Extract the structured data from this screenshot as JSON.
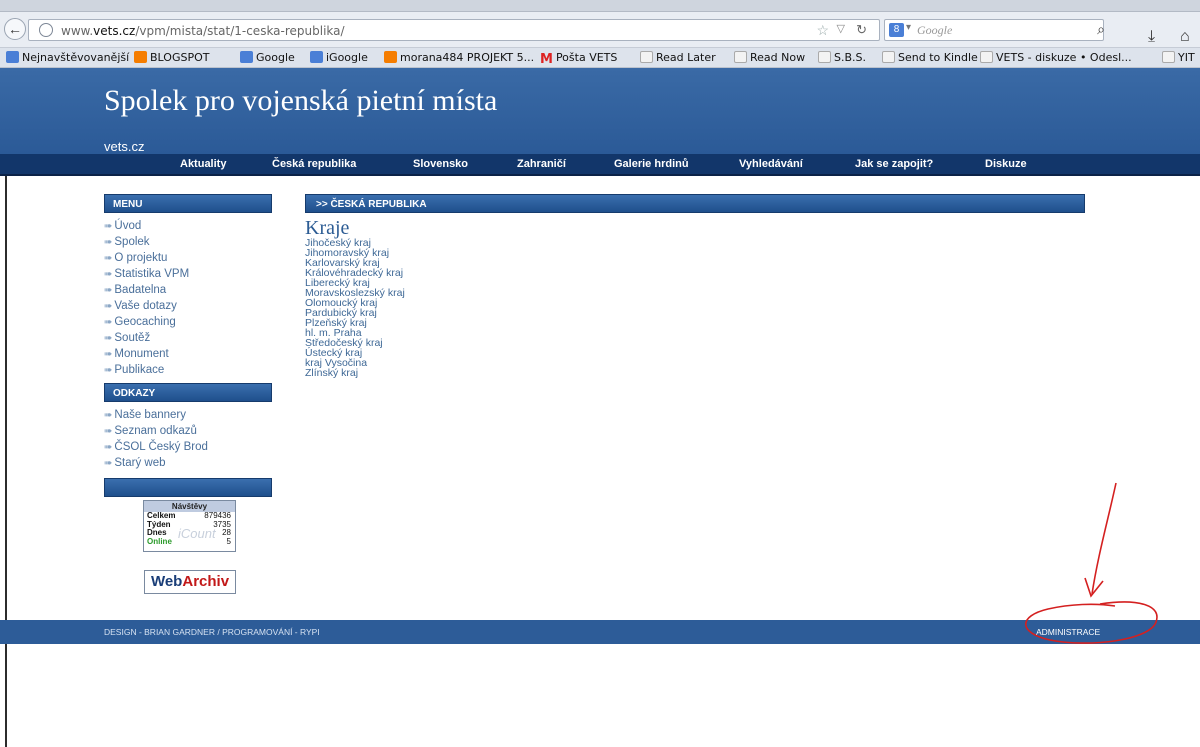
{
  "browser": {
    "url_prefix": "www.",
    "url_domain": "vets.cz",
    "url_path": "/vpm/mista/stat/1-ceska-republika/",
    "search_placeholder": "Google",
    "search_badge": "8",
    "bookmarks": [
      {
        "icon": "star",
        "label": "Nejnavštěvovanější"
      },
      {
        "icon": "blogger",
        "label": "BLOGSPOT"
      },
      {
        "icon": "google",
        "label": "Google"
      },
      {
        "icon": "google",
        "label": "iGoogle"
      },
      {
        "icon": "blogger",
        "label": "morana484 PROJEKT 5..."
      },
      {
        "icon": "gmail",
        "label": "Pošta VETS"
      },
      {
        "icon": "page",
        "label": "Read Later"
      },
      {
        "icon": "page",
        "label": "Read Now"
      },
      {
        "icon": "page",
        "label": "S.B.S."
      },
      {
        "icon": "page",
        "label": "Send to Kindle"
      },
      {
        "icon": "page",
        "label": "VETS - diskuze • Odesl..."
      },
      {
        "icon": "page",
        "label": "YIT"
      }
    ]
  },
  "site": {
    "title": "Spolek pro vojenská pietní místa",
    "domain": "vets.cz"
  },
  "nav": [
    "Aktuality",
    "Česká republika",
    "Slovensko",
    "Zahraničí",
    "Galerie hrdinů",
    "Vyhledávání",
    "Jak se zapojit?",
    "Diskuze"
  ],
  "sidebar": {
    "menu_title": "MENU",
    "menu_items": [
      "Úvod",
      "Spolek",
      "O projektu",
      "Statistika VPM",
      "Badatelna",
      "Vaše dotazy",
      "Geocaching",
      "Soutěž",
      "Monument",
      "Publikace"
    ],
    "links_title": "ODKAZY",
    "link_items": [
      "Naše bannery",
      "Seznam odkazů",
      "ČSOL Český Brod",
      "Starý web"
    ],
    "empty_title": ""
  },
  "counter": {
    "title": "Návštěvy",
    "rows": [
      {
        "label": "Celkem",
        "value": "879436"
      },
      {
        "label": "Týden",
        "value": "3735"
      },
      {
        "label": "Dnes",
        "value": "28"
      },
      {
        "label": "Online",
        "value": "5"
      }
    ],
    "watermark": "iCount"
  },
  "webarchiv": {
    "part1": "Web",
    "part2": "Archiv"
  },
  "content": {
    "header": ">> ČESKÁ REPUBLIKA",
    "title": "Kraje",
    "regions": [
      "Jihočeský kraj",
      "Jihomoravský kraj",
      "Karlovarský kraj",
      "Královéhradecký kraj",
      "Liberecký kraj",
      "Moravskoslezský kraj",
      "Olomoucký kraj",
      "Pardubický kraj",
      "Plzeňský kraj",
      "hl. m. Praha",
      "Středočeský kraj",
      "Ústecký kraj",
      "kraj Vysočina",
      "Zlínský kraj"
    ]
  },
  "footer": {
    "credit": "DESIGN - BRIAN GARDNER / PROGRAMOVÁNÍ - RYPI",
    "admin": "ADMINISTRACE"
  },
  "colors": {
    "banner": "#2b5a97",
    "navbar": "#12366a",
    "link": "#3e6896",
    "annotation": "#d42020"
  }
}
